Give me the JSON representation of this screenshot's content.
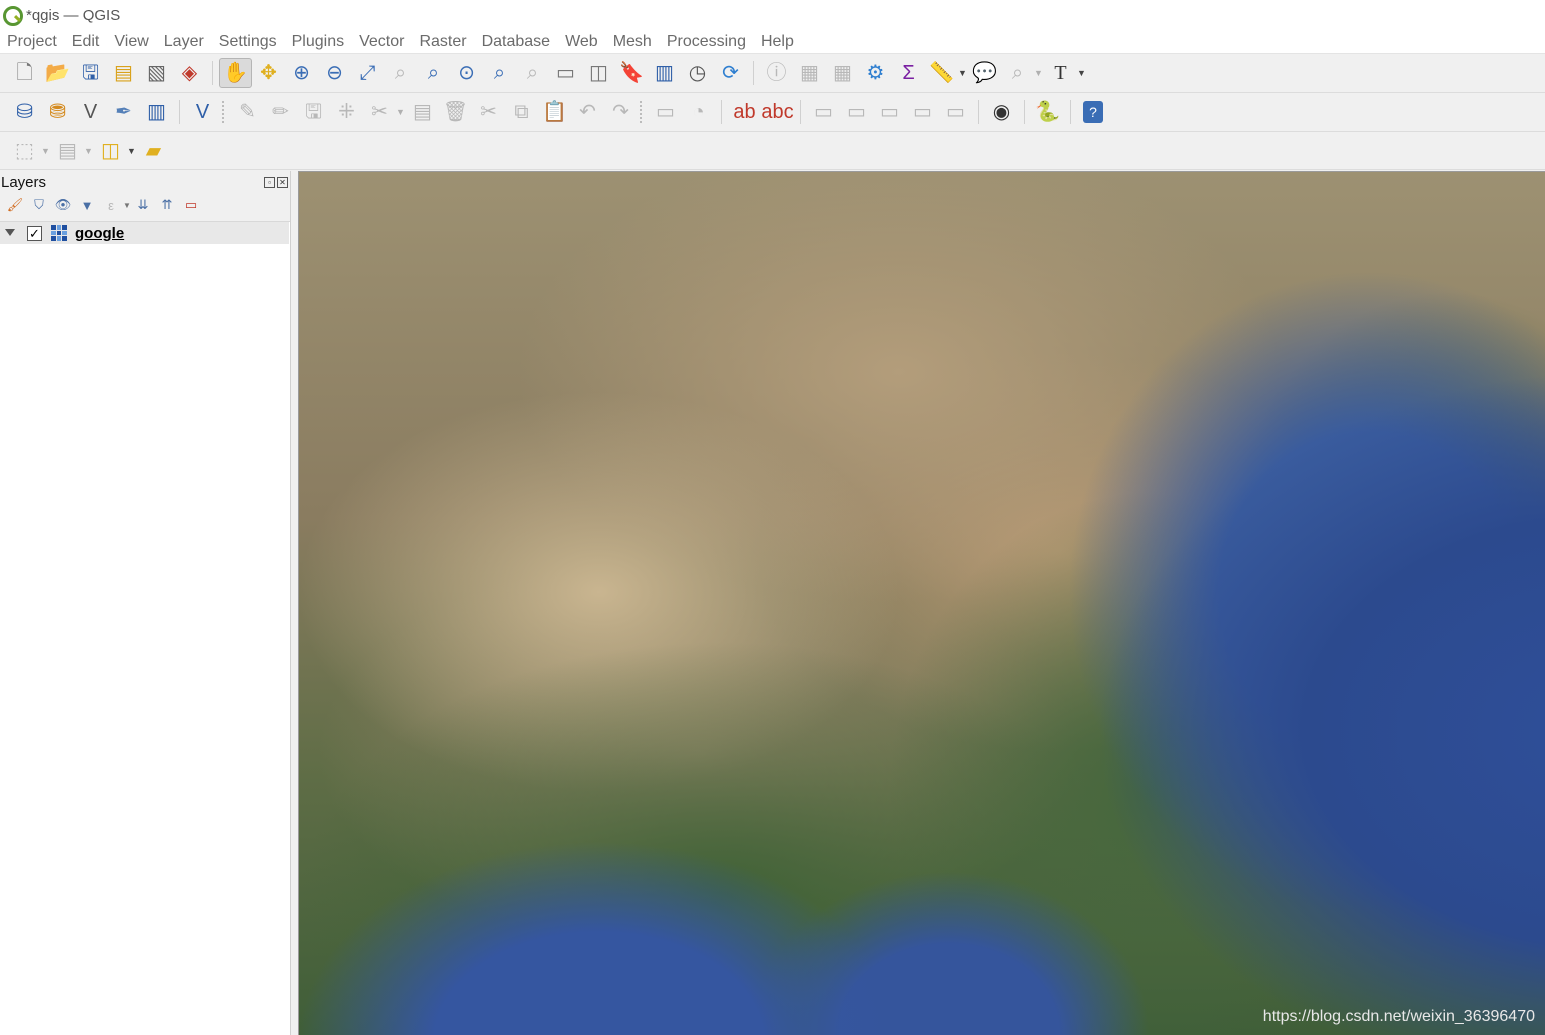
{
  "window": {
    "title": "*qgis — QGIS",
    "app_icon": "qgis-logo-icon"
  },
  "menubar": {
    "items": [
      {
        "label": "Project"
      },
      {
        "label": "Edit"
      },
      {
        "label": "View"
      },
      {
        "label": "Layer"
      },
      {
        "label": "Settings"
      },
      {
        "label": "Plugins"
      },
      {
        "label": "Vector"
      },
      {
        "label": "Raster"
      },
      {
        "label": "Database"
      },
      {
        "label": "Web"
      },
      {
        "label": "Mesh"
      },
      {
        "label": "Processing"
      },
      {
        "label": "Help"
      }
    ]
  },
  "layers_panel": {
    "title": "Layers",
    "layers": [
      {
        "name": "google",
        "visible": true,
        "expanded": true,
        "type_icon": "raster-layer-icon"
      }
    ]
  },
  "map": {
    "watermark": "https://blog.csdn.net/weixin_36396470",
    "colors": {
      "ocean": "#2f4f9a",
      "land_green": "#3f6236",
      "desert": "#c9b590"
    }
  }
}
